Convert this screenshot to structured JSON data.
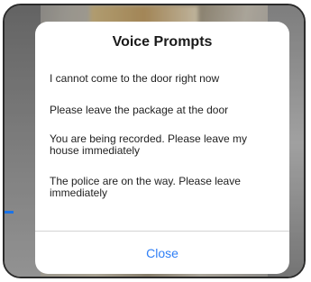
{
  "dialog": {
    "title": "Voice Prompts",
    "prompts": [
      "I cannot come to the door right now",
      "Please leave the package at the door",
      "You are being recorded.  Please leave my house immediately",
      "The police are on the way.  Please leave immediately"
    ],
    "close_label": "Close"
  },
  "colors": {
    "accent": "#2f7ff6",
    "divider": "#d4d4d4"
  }
}
